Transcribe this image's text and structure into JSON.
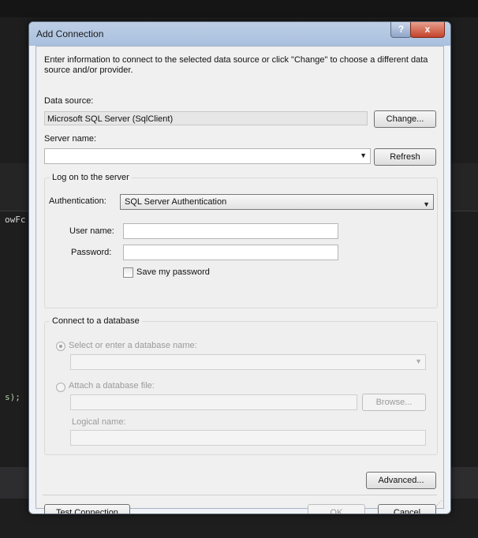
{
  "background": {
    "code_fragment_1": "owFc",
    "code_fragment_2": "s);"
  },
  "dialog": {
    "title": "Add Connection",
    "help_label": "?",
    "close_label": "x",
    "intro_text": "Enter information to connect to the selected data source or click \"Change\" to choose a different data source and/or provider.",
    "data_source": {
      "label": "Data source:",
      "value": "Microsoft SQL Server (SqlClient)",
      "change_button": "Change..."
    },
    "server_name": {
      "label": "Server name:",
      "value": "",
      "refresh_button": "Refresh"
    },
    "logon_group": {
      "title": "Log on to the server",
      "authentication_label": "Authentication:",
      "authentication_value": "SQL Server Authentication",
      "username_label": "User name:",
      "username_value": "",
      "password_label": "Password:",
      "password_value": "",
      "save_password_label": "Save my password"
    },
    "database_group": {
      "title": "Connect to a database",
      "select_radio_label": "Select or enter a database name:",
      "database_value": "",
      "attach_radio_label": "Attach a database file:",
      "file_value": "",
      "browse_button": "Browse...",
      "logical_name_label": "Logical name:",
      "logical_name_value": ""
    },
    "advanced_button": "Advanced...",
    "test_connection_button": "Test Connection",
    "ok_button": "OK",
    "cancel_button": "Cancel"
  }
}
